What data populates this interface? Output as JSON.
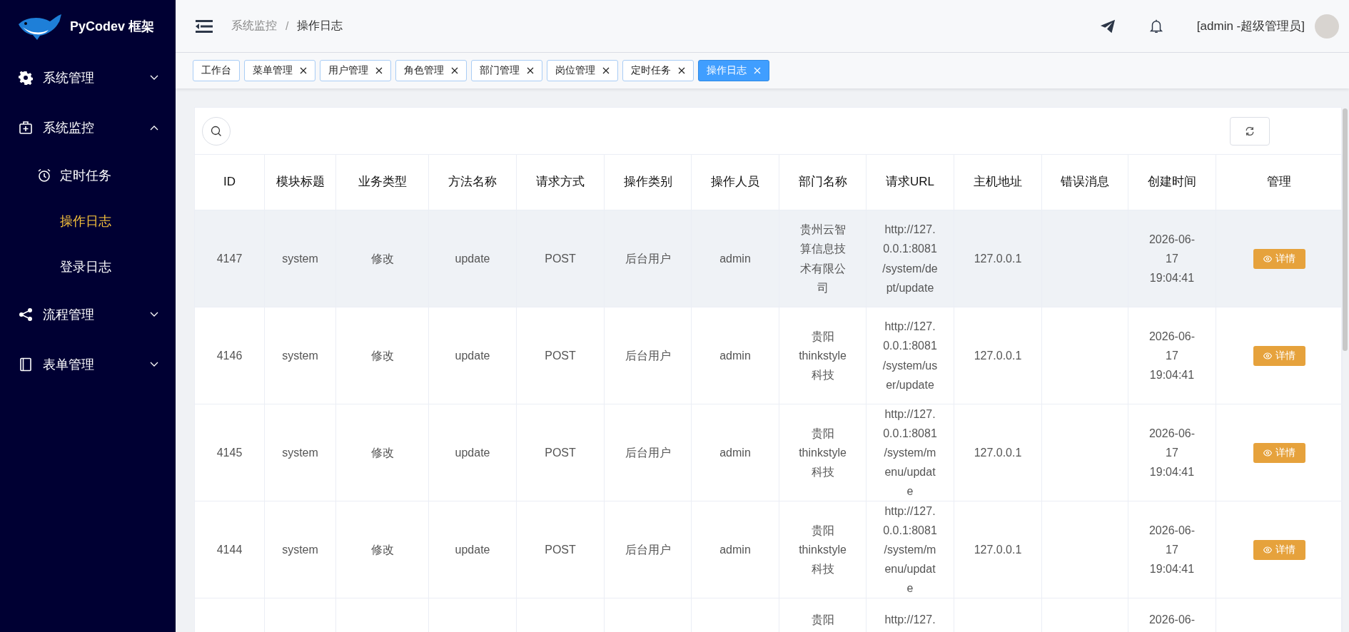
{
  "sidebar": {
    "logo_text": "PyCodev 框架",
    "items": [
      {
        "label": "系统管理",
        "expanded": false
      },
      {
        "label": "系统监控",
        "expanded": true,
        "children": [
          {
            "label": "定时任务",
            "selected": false
          },
          {
            "label": "操作日志",
            "selected": true
          },
          {
            "label": "登录日志",
            "selected": false
          }
        ]
      },
      {
        "label": "流程管理",
        "expanded": false
      },
      {
        "label": "表单管理",
        "expanded": false
      }
    ]
  },
  "header": {
    "breadcrumb": [
      "系统监控",
      "操作日志"
    ],
    "breadcrumb_separator": "/",
    "user": "[admin -超级管理员]"
  },
  "tabs": [
    {
      "label": "工作台",
      "closable": false,
      "selected": false
    },
    {
      "label": "菜单管理",
      "closable": true,
      "selected": false
    },
    {
      "label": "用户管理",
      "closable": true,
      "selected": false
    },
    {
      "label": "角色管理",
      "closable": true,
      "selected": false
    },
    {
      "label": "部门管理",
      "closable": true,
      "selected": false
    },
    {
      "label": "岗位管理",
      "closable": true,
      "selected": false
    },
    {
      "label": "定时任务",
      "closable": true,
      "selected": false
    },
    {
      "label": "操作日志",
      "closable": true,
      "selected": true
    }
  ],
  "table": {
    "columns": [
      "ID",
      "模块标题",
      "业务类型",
      "方法名称",
      "请求方式",
      "操作类别",
      "操作人员",
      "部门名称",
      "请求URL",
      "主机地址",
      "错误消息",
      "创建时间",
      "管理"
    ],
    "rows": [
      {
        "hovered": true,
        "cells": [
          "4147",
          "system",
          "修改",
          "update",
          "POST",
          "后台用户",
          "admin",
          "贵州云智算信息技术有限公司",
          "http://127.0.0.1:8081/system/dept/update",
          "127.0.0.1",
          "",
          "2026-06-17 19:04:41"
        ],
        "action": "详情"
      },
      {
        "hovered": false,
        "cells": [
          "4146",
          "system",
          "修改",
          "update",
          "POST",
          "后台用户",
          "admin",
          "贵阳thinkstyle科技",
          "http://127.0.0.1:8081/system/user/update",
          "127.0.0.1",
          "",
          "2026-06-17 19:04:41"
        ],
        "action": "详情"
      },
      {
        "hovered": false,
        "cells": [
          "4145",
          "system",
          "修改",
          "update",
          "POST",
          "后台用户",
          "admin",
          "贵阳thinkstyle科技",
          "http://127.0.0.1:8081/system/menu/update",
          "127.0.0.1",
          "",
          "2026-06-17 19:04:41"
        ],
        "action": "详情"
      },
      {
        "hovered": false,
        "cells": [
          "4144",
          "system",
          "修改",
          "update",
          "POST",
          "后台用户",
          "admin",
          "贵阳thinkstyle科技",
          "http://127.0.0.1:8081/system/menu/update",
          "127.0.0.1",
          "",
          "2026-06-17 19:04:41"
        ],
        "action": "详情"
      },
      {
        "hovered": false,
        "cells": [
          "",
          "",
          "",
          "",
          "",
          "",
          "",
          "贵阳",
          "http://127.",
          "",
          "",
          "2026-06-"
        ]
      }
    ]
  }
}
